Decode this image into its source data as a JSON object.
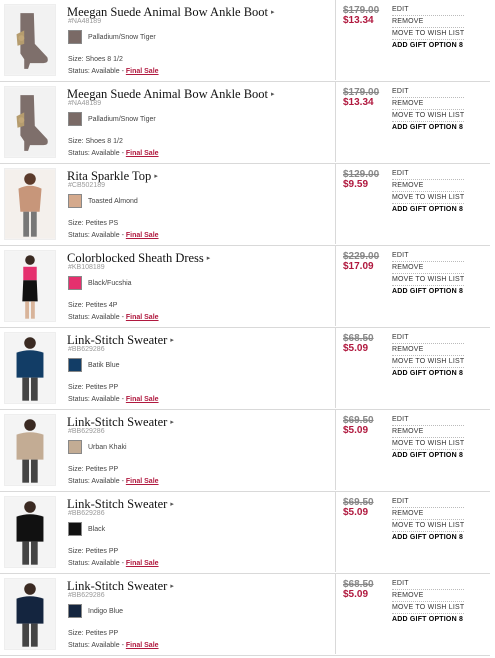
{
  "cart": {
    "items": [
      {
        "name": "Meegan Suede Animal Bow Ankle Boot",
        "sku": "#NA48189",
        "color_name": "Palladium/Snow Tiger",
        "swatch": "#7a6a66",
        "size": "Size: Shoes 8 1/2",
        "status_label": "Status: Available -",
        "sale_label": "Final Sale",
        "price_old": "$179.00",
        "price_new": "$13.34",
        "thumb": "boot-image"
      },
      {
        "name": "Meegan Suede Animal Bow Ankle Boot",
        "sku": "#NA48189",
        "color_name": "Palladium/Snow Tiger",
        "swatch": "#7a6a66",
        "size": "Size: Shoes 8 1/2",
        "status_label": "Status: Available -",
        "sale_label": "Final Sale",
        "price_old": "$179.00",
        "price_new": "$13.34",
        "thumb": "boot-image"
      },
      {
        "name": "Rita Sparkle Top",
        "sku": "#CB502189",
        "color_name": "Toasted Almond",
        "swatch": "#d4a98c",
        "size": "Size: Petites PS",
        "status_label": "Status: Available -",
        "sale_label": "Final Sale",
        "price_old": "$129.00",
        "price_new": "$9.59",
        "thumb": "top-image"
      },
      {
        "name": "Colorblocked Sheath Dress",
        "sku": "#KB108189",
        "color_name": "Black/Fucshia",
        "swatch": "#e5306e",
        "size": "Size: Petites 4P",
        "status_label": "Status: Available -",
        "sale_label": "Final Sale",
        "price_old": "$229.00",
        "price_new": "$17.09",
        "thumb": "dress-image"
      },
      {
        "name": "Link-Stitch Sweater",
        "sku": "#BB629286",
        "color_name": "Batik Blue",
        "swatch": "#123d66",
        "size": "Size: Petites PP",
        "status_label": "Status: Available -",
        "sale_label": "Final Sale",
        "price_old": "$68.50",
        "price_new": "$5.09",
        "thumb": "sweater-image"
      },
      {
        "name": "Link-Stitch Sweater",
        "sku": "#BB629286",
        "color_name": "Urban Khaki",
        "swatch": "#c3ac94",
        "size": "Size: Petites PP",
        "status_label": "Status: Available -",
        "sale_label": "Final Sale",
        "price_old": "$69.50",
        "price_new": "$5.09",
        "thumb": "sweater-image"
      },
      {
        "name": "Link-Stitch Sweater",
        "sku": "#BB629286",
        "color_name": "Black",
        "swatch": "#111111",
        "size": "Size: Petites PP",
        "status_label": "Status: Available -",
        "sale_label": "Final Sale",
        "price_old": "$69.50",
        "price_new": "$5.09",
        "thumb": "sweater-image"
      },
      {
        "name": "Link-Stitch Sweater",
        "sku": "#BB629286",
        "color_name": "Indigo Blue",
        "swatch": "#14253f",
        "size": "Size: Petites PP",
        "status_label": "Status: Available -",
        "sale_label": "Final Sale",
        "price_old": "$68.50",
        "price_new": "$5.09",
        "thumb": "sweater-image"
      }
    ],
    "actions": {
      "edit": "EDIT",
      "remove": "REMOVE",
      "wishlist": "MOVE TO WISH LIST",
      "gift": "ADD GIFT OPTION 8"
    },
    "arrow_glyph": "▸"
  }
}
